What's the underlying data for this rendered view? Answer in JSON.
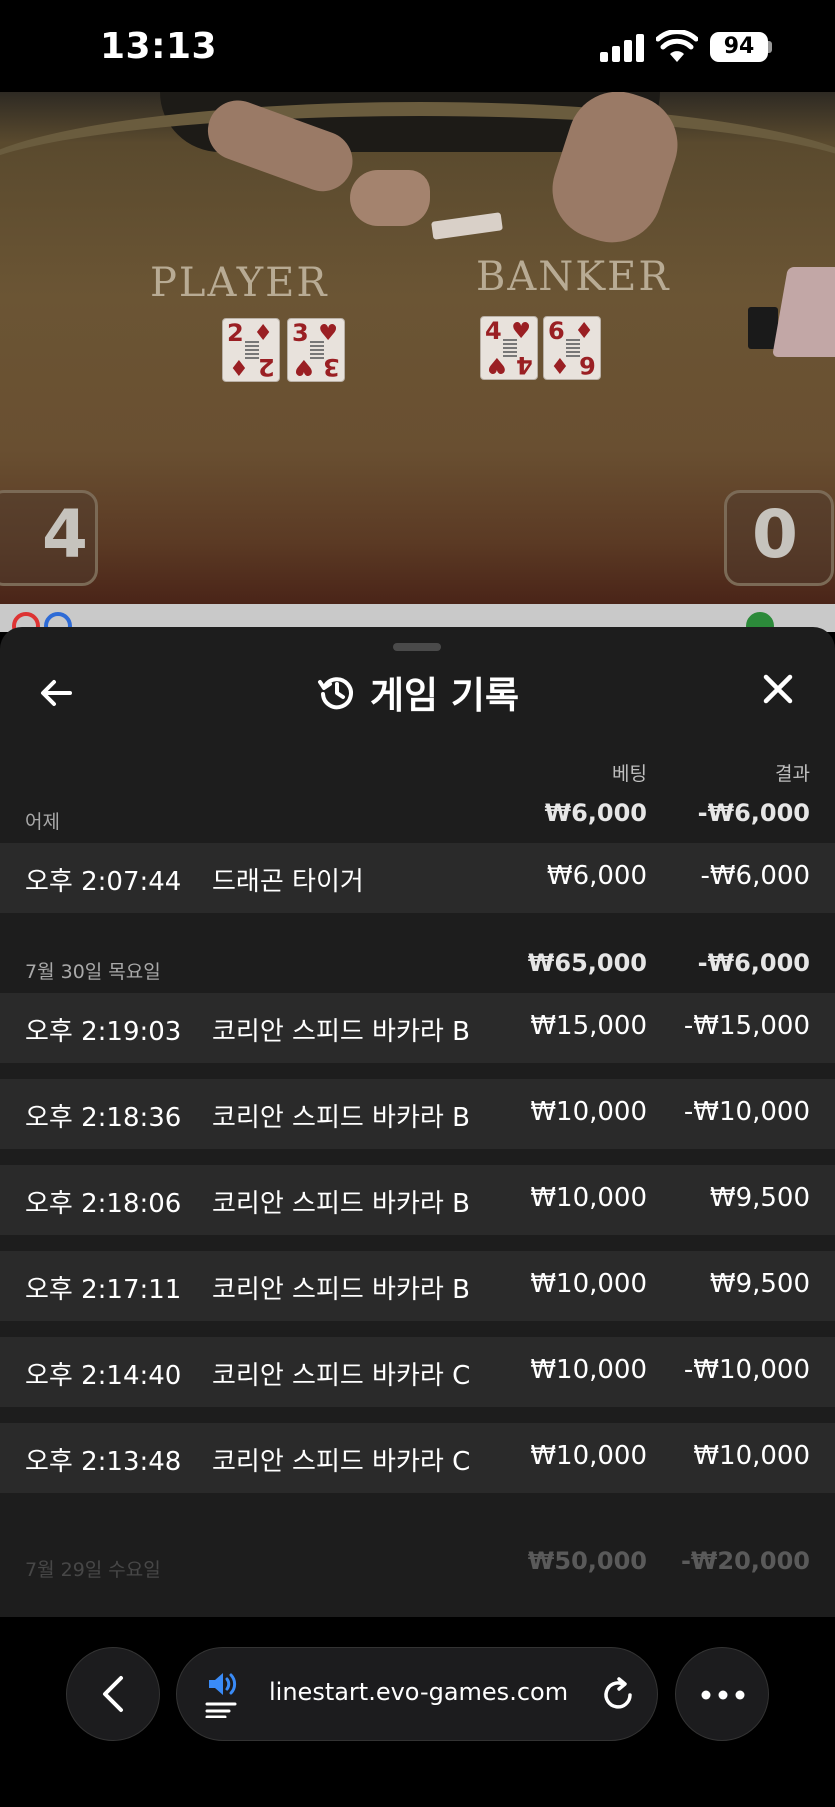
{
  "status_bar": {
    "time": "13:13",
    "battery": "94"
  },
  "game": {
    "player_label": "PLAYER",
    "banker_label": "BANKER",
    "player_cards": [
      {
        "rank": "2",
        "suit": "♦"
      },
      {
        "rank": "3",
        "suit": "♥"
      }
    ],
    "banker_cards": [
      {
        "rank": "4",
        "suit": "♥"
      },
      {
        "rank": "6",
        "suit": "♦"
      }
    ],
    "player_score": "4",
    "banker_score": "0"
  },
  "sheet": {
    "title": "게임 기록",
    "columns": {
      "bet": "베팅",
      "result": "결과"
    },
    "groups": [
      {
        "label": "어제",
        "bet_total": "₩6,000",
        "result_total": "-₩6,000",
        "rows": [
          {
            "time": "오후 2:07:44",
            "game": "드래곤 타이거",
            "bet": "₩6,000",
            "result": "-₩6,000"
          }
        ]
      },
      {
        "label": "7월 30일 목요일",
        "bet_total": "₩65,000",
        "result_total": "-₩6,000",
        "rows": [
          {
            "time": "오후 2:19:03",
            "game": "코리안 스피드 바카라 B",
            "bet": "₩15,000",
            "result": "-₩15,000"
          },
          {
            "time": "오후 2:18:36",
            "game": "코리안 스피드 바카라 B",
            "bet": "₩10,000",
            "result": "-₩10,000"
          },
          {
            "time": "오후 2:18:06",
            "game": "코리안 스피드 바카라 B",
            "bet": "₩10,000",
            "result": "₩9,500"
          },
          {
            "time": "오후 2:17:11",
            "game": "코리안 스피드 바카라 B",
            "bet": "₩10,000",
            "result": "₩9,500"
          },
          {
            "time": "오후 2:14:40",
            "game": "코리안 스피드 바카라 C",
            "bet": "₩10,000",
            "result": "-₩10,000"
          },
          {
            "time": "오후 2:13:48",
            "game": "코리안 스피드 바카라 C",
            "bet": "₩10,000",
            "result": "₩10,000"
          }
        ]
      },
      {
        "label": "7월 29일 수요일",
        "bet_total": "₩50,000",
        "result_total": "-₩20,000",
        "rows": []
      }
    ]
  },
  "browser": {
    "url": "linestart.evo-games.com"
  },
  "icons": {
    "back": "arrow-left-icon",
    "history": "history-icon",
    "close": "close-icon",
    "browser_back": "chevron-left-icon",
    "speaker": "speaker-icon",
    "reload": "reload-icon",
    "more": "more-icon"
  }
}
